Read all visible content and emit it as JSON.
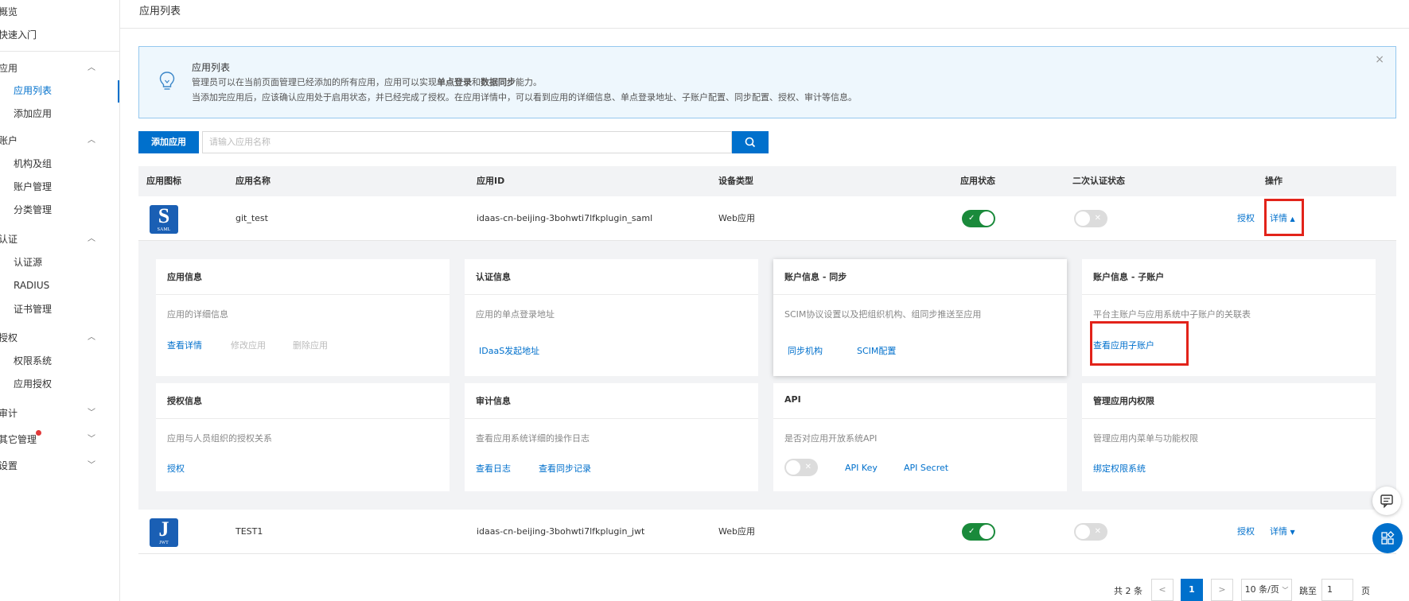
{
  "sidebar": {
    "items": [
      {
        "label": "概览",
        "type": "group"
      },
      {
        "label": "快速入门",
        "type": "group"
      },
      {
        "label": "应用",
        "type": "group"
      },
      {
        "label": "应用列表",
        "type": "sub"
      },
      {
        "label": "添加应用",
        "type": "sub"
      },
      {
        "label": "账户",
        "type": "group"
      },
      {
        "label": "机构及组",
        "type": "sub"
      },
      {
        "label": "账户管理",
        "type": "sub"
      },
      {
        "label": "分类管理",
        "type": "sub"
      },
      {
        "label": "认证",
        "type": "group"
      },
      {
        "label": "认证源",
        "type": "sub"
      },
      {
        "label": "RADIUS",
        "type": "sub"
      },
      {
        "label": "证书管理",
        "type": "sub"
      },
      {
        "label": "授权",
        "type": "group"
      },
      {
        "label": "权限系统",
        "type": "sub"
      },
      {
        "label": "应用授权",
        "type": "sub"
      },
      {
        "label": "审计",
        "type": "group"
      },
      {
        "label": "其它管理",
        "type": "group"
      },
      {
        "label": "设置",
        "type": "group"
      }
    ],
    "active": "应用列表"
  },
  "page": {
    "title": "应用列表"
  },
  "notice": {
    "title": "应用列表",
    "line1_a": "管理员可以在当前页面管理已经添加的所有应用，应用可以实现",
    "line1_b": "单点登录",
    "line1_c": "和",
    "line1_d": "数据同步",
    "line1_e": "能力。",
    "line2": "当添加完应用后，应该确认应用处于启用状态，并已经完成了授权。在应用详情中，可以看到应用的详细信息、单点登录地址、子账户配置、同步配置、授权、审计等信息。",
    "close": "×"
  },
  "toolbar": {
    "add_label": "添加应用",
    "search_placeholder": "请输入应用名称"
  },
  "table": {
    "headers": [
      "应用图标",
      "应用名称",
      "应用ID",
      "设备类型",
      "应用状态",
      "二次认证状态",
      "操作"
    ],
    "rows": [
      {
        "logo_big": "S",
        "logo_small": "SAML",
        "name": "git_test",
        "id": "idaas-cn-beijing-3bohwti7lfkplugin_saml",
        "device": "Web应用",
        "status_on": true,
        "mfa_on": false,
        "auth": "授权",
        "detail": "详情",
        "expanded": true
      },
      {
        "logo_big": "J",
        "logo_small": "JWT",
        "name": "TEST1",
        "id": "idaas-cn-beijing-3bohwti7lfkplugin_jwt",
        "device": "Web应用",
        "status_on": true,
        "mfa_on": false,
        "auth": "授权",
        "detail": "详情",
        "expanded": false
      }
    ]
  },
  "cards": {
    "app_info": {
      "title": "应用信息",
      "desc": "应用的详细信息",
      "links": [
        "查看详情",
        "修改应用",
        "删除应用"
      ]
    },
    "auth_info": {
      "title": "认证信息",
      "desc": "应用的单点登录地址",
      "links": [
        "IDaaS发起地址"
      ]
    },
    "sync_info": {
      "title": "账户信息 - 同步",
      "desc": "SCIM协议设置以及把组织机构、组同步推送至应用",
      "links": [
        "同步机构",
        "SCIM配置"
      ]
    },
    "subaccount_info": {
      "title": "账户信息 - 子账户",
      "desc": "平台主账户与应用系统中子账户的关联表",
      "links": [
        "查看应用子账户"
      ]
    },
    "grant_info": {
      "title": "授权信息",
      "desc": "应用与人员组织的授权关系",
      "links": [
        "授权"
      ]
    },
    "audit_info": {
      "title": "审计信息",
      "desc": "查看应用系统详细的操作日志",
      "links": [
        "查看日志",
        "查看同步记录"
      ]
    },
    "api_info": {
      "title": "API",
      "desc": "是否对应用开放系统API",
      "links": [
        "API Key",
        "API Secret"
      ]
    },
    "perm_info": {
      "title": "管理应用内权限",
      "desc": "管理应用内菜单与功能权限",
      "links": [
        "绑定权限系统"
      ]
    }
  },
  "pagination": {
    "total": "共 2 条",
    "prev": "<",
    "current": "1",
    "next": ">",
    "page_size": "10 条/页",
    "jump_label": "跳至",
    "jump_value": "1",
    "page_suffix": "页"
  },
  "colors": {
    "primary": "#0070cc",
    "success": "#1a8a3b",
    "highlight": "#e2231a"
  }
}
